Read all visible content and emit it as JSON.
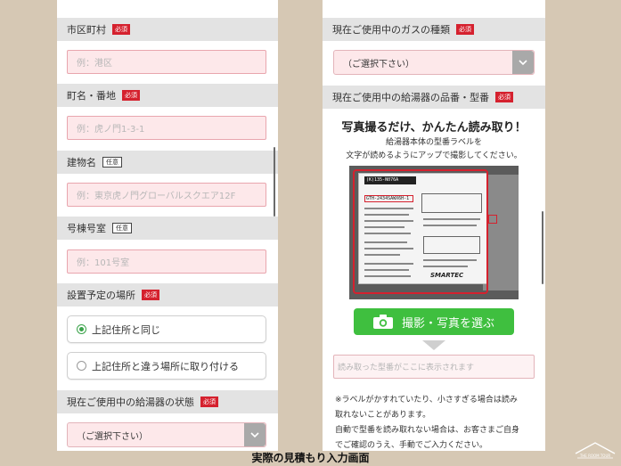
{
  "left": {
    "city": {
      "label": "市区町村",
      "badge": "必須",
      "placeholder": "例：港区"
    },
    "street": {
      "label": "町名・番地",
      "badge": "必須",
      "placeholder": "例：虎ノ門1-3-1"
    },
    "building": {
      "label": "建物名",
      "badge": "任意",
      "placeholder": "例：東京虎ノ門グローバルスクエア12F"
    },
    "room": {
      "label": "号棟号室",
      "badge": "任意",
      "placeholder": "例：101号室"
    },
    "location": {
      "label": "設置予定の場所",
      "badge": "必須",
      "options": [
        "上記住所と同じ",
        "上記住所と違う場所に取り付ける"
      ],
      "selected_index": 0
    },
    "heater_state": {
      "label": "現在ご使用中の給湯器の状態",
      "badge": "必須",
      "value": "（ご選択下さい）"
    }
  },
  "right": {
    "gas": {
      "label": "現在ご使用中のガスの種類",
      "badge": "必須",
      "value": "（ご選択下さい）"
    },
    "model": {
      "label": "現在ご使用中の給湯器の品番・型番",
      "badge": "必須"
    },
    "hero_title": "写真撮るだけ、かんたん読み取り！",
    "hero_line1": "給湯器本体の型番ラベルを",
    "hero_line2": "文字が読めるようにアップで撮影してください。",
    "photo": {
      "top_code": "(K)135-N076A",
      "model_code": "GTH-2434SAWX6H-1",
      "brand": "SMARTEC"
    },
    "photo_button": "撮影・写真を選ぶ",
    "result_placeholder": "読み取った型番がここに表示されます",
    "notes": [
      "※ラベルがかすれていたり、小さすぎる場合は読み",
      "取れないことがあります。",
      "自動で型番を読み取れない場合は、お客さまご自身",
      "でご確認のうえ、手動でご入力ください。"
    ]
  },
  "caption": "実際の見積もり入力画面",
  "logo_text": "THE ROOM TOUR",
  "colors": {
    "required_badge": "#d5212e",
    "field_bg": "#fde8ea",
    "field_border": "#e9a6ae",
    "section_head": "#e3e3e3",
    "photo_button": "#3fbf3f",
    "background": "#d6c8b4"
  },
  "icons": {
    "camera": "camera-icon",
    "chevron": "chevron-down-icon"
  }
}
